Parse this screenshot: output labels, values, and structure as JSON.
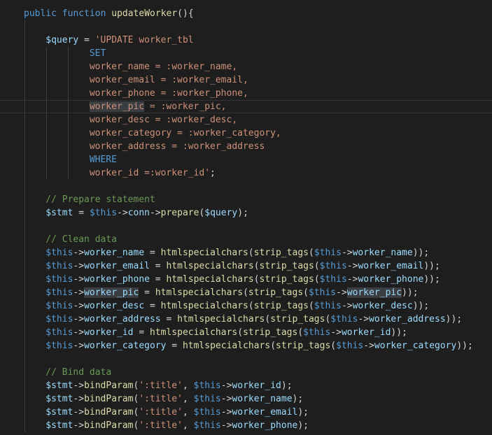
{
  "colors": {
    "background": "#1e1e1e",
    "keyword": "#569cd6",
    "function": "#dcdcaa",
    "variable": "#9cdcfe",
    "string": "#ce9178",
    "comment": "#6a9955",
    "default": "#d4d4d4",
    "indent_guide": "#404040",
    "line_highlight_border": "#333333",
    "word_highlight": "#3a3d41"
  },
  "highlighted_line": 8,
  "code_lines": [
    {
      "indent": 0,
      "guides": [],
      "tokens": [
        {
          "t": "public",
          "c": "keyword"
        },
        {
          "t": " "
        },
        {
          "t": "function",
          "c": "keyword"
        },
        {
          "t": " "
        },
        {
          "t": "updateWorker",
          "c": "function"
        },
        {
          "t": "(){"
        }
      ]
    },
    {
      "indent": 0,
      "guides": [
        1
      ],
      "tokens": []
    },
    {
      "indent": 2,
      "guides": [
        1
      ],
      "tokens": [
        {
          "t": "$query",
          "c": "variable"
        },
        {
          "t": " = "
        },
        {
          "t": "'UPDATE worker_tbl",
          "c": "string"
        }
      ]
    },
    {
      "indent": 6,
      "guides": [
        1,
        2,
        3
      ],
      "tokens": [
        {
          "t": "SET",
          "c": "keyword"
        }
      ]
    },
    {
      "indent": 6,
      "guides": [
        1,
        2,
        3
      ],
      "tokens": [
        {
          "t": "worker_name = :worker_name,",
          "c": "string"
        }
      ]
    },
    {
      "indent": 6,
      "guides": [
        1,
        2,
        3
      ],
      "tokens": [
        {
          "t": "worker_email = :worker_email,",
          "c": "string"
        }
      ]
    },
    {
      "indent": 6,
      "guides": [
        1,
        2,
        3
      ],
      "tokens": [
        {
          "t": "worker_phone = :worker_phone,",
          "c": "string"
        }
      ]
    },
    {
      "indent": 6,
      "guides": [
        1,
        2,
        3
      ],
      "tokens": [
        {
          "t": "worker_pic",
          "c": "string",
          "hl": true
        },
        {
          "t": " = :worker_pic,",
          "c": "string"
        }
      ]
    },
    {
      "indent": 6,
      "guides": [
        1,
        2,
        3
      ],
      "tokens": [
        {
          "t": "worker_desc = :worker_desc,",
          "c": "string"
        }
      ]
    },
    {
      "indent": 6,
      "guides": [
        1,
        2,
        3
      ],
      "tokens": [
        {
          "t": "worker_category = :worker_category,",
          "c": "string"
        }
      ]
    },
    {
      "indent": 6,
      "guides": [
        1,
        2,
        3
      ],
      "tokens": [
        {
          "t": "worker_address = :worker_address",
          "c": "string"
        }
      ]
    },
    {
      "indent": 6,
      "guides": [
        1,
        2,
        3
      ],
      "tokens": [
        {
          "t": "WHERE",
          "c": "keyword"
        }
      ]
    },
    {
      "indent": 6,
      "guides": [
        1,
        2,
        3
      ],
      "tokens": [
        {
          "t": "worker_id =:worker_id'",
          "c": "string"
        },
        {
          "t": ";"
        }
      ]
    },
    {
      "indent": 0,
      "guides": [
        1
      ],
      "tokens": []
    },
    {
      "indent": 2,
      "guides": [
        1
      ],
      "tokens": [
        {
          "t": "// Prepare statement",
          "c": "comment"
        }
      ]
    },
    {
      "indent": 2,
      "guides": [
        1
      ],
      "tokens": [
        {
          "t": "$stmt",
          "c": "variable"
        },
        {
          "t": " = "
        },
        {
          "t": "$this",
          "c": "keyword"
        },
        {
          "t": "->"
        },
        {
          "t": "conn",
          "c": "variable"
        },
        {
          "t": "->"
        },
        {
          "t": "prepare",
          "c": "function"
        },
        {
          "t": "("
        },
        {
          "t": "$query",
          "c": "variable"
        },
        {
          "t": ");"
        }
      ]
    },
    {
      "indent": 0,
      "guides": [
        1
      ],
      "tokens": []
    },
    {
      "indent": 2,
      "guides": [
        1
      ],
      "tokens": [
        {
          "t": "// Clean data",
          "c": "comment"
        }
      ]
    },
    {
      "indent": 2,
      "guides": [
        1
      ],
      "tokens": [
        {
          "t": "$this",
          "c": "keyword"
        },
        {
          "t": "->"
        },
        {
          "t": "worker_name",
          "c": "variable"
        },
        {
          "t": " = "
        },
        {
          "t": "htmlspecialchars",
          "c": "function"
        },
        {
          "t": "("
        },
        {
          "t": "strip_tags",
          "c": "function"
        },
        {
          "t": "("
        },
        {
          "t": "$this",
          "c": "keyword"
        },
        {
          "t": "->"
        },
        {
          "t": "worker_name",
          "c": "variable"
        },
        {
          "t": "));"
        }
      ]
    },
    {
      "indent": 2,
      "guides": [
        1
      ],
      "tokens": [
        {
          "t": "$this",
          "c": "keyword"
        },
        {
          "t": "->"
        },
        {
          "t": "worker_email",
          "c": "variable"
        },
        {
          "t": " = "
        },
        {
          "t": "htmlspecialchars",
          "c": "function"
        },
        {
          "t": "("
        },
        {
          "t": "strip_tags",
          "c": "function"
        },
        {
          "t": "("
        },
        {
          "t": "$this",
          "c": "keyword"
        },
        {
          "t": "->"
        },
        {
          "t": "worker_email",
          "c": "variable"
        },
        {
          "t": "));"
        }
      ]
    },
    {
      "indent": 2,
      "guides": [
        1
      ],
      "tokens": [
        {
          "t": "$this",
          "c": "keyword"
        },
        {
          "t": "->"
        },
        {
          "t": "worker_phone",
          "c": "variable"
        },
        {
          "t": " = "
        },
        {
          "t": "htmlspecialchars",
          "c": "function"
        },
        {
          "t": "("
        },
        {
          "t": "strip_tags",
          "c": "function"
        },
        {
          "t": "("
        },
        {
          "t": "$this",
          "c": "keyword"
        },
        {
          "t": "->"
        },
        {
          "t": "worker_phone",
          "c": "variable"
        },
        {
          "t": "));"
        }
      ]
    },
    {
      "indent": 2,
      "guides": [
        1
      ],
      "tokens": [
        {
          "t": "$this",
          "c": "keyword"
        },
        {
          "t": "->"
        },
        {
          "t": "worker_pic",
          "c": "variable",
          "hl": true
        },
        {
          "t": " = "
        },
        {
          "t": "htmlspecialchars",
          "c": "function"
        },
        {
          "t": "("
        },
        {
          "t": "strip_tags",
          "c": "function"
        },
        {
          "t": "("
        },
        {
          "t": "$this",
          "c": "keyword"
        },
        {
          "t": "->"
        },
        {
          "t": "worker_pic",
          "c": "variable",
          "hl": true
        },
        {
          "t": "));"
        }
      ]
    },
    {
      "indent": 2,
      "guides": [
        1
      ],
      "tokens": [
        {
          "t": "$this",
          "c": "keyword"
        },
        {
          "t": "->"
        },
        {
          "t": "worker_desc",
          "c": "variable"
        },
        {
          "t": " = "
        },
        {
          "t": "htmlspecialchars",
          "c": "function"
        },
        {
          "t": "("
        },
        {
          "t": "strip_tags",
          "c": "function"
        },
        {
          "t": "("
        },
        {
          "t": "$this",
          "c": "keyword"
        },
        {
          "t": "->"
        },
        {
          "t": "worker_desc",
          "c": "variable"
        },
        {
          "t": "));"
        }
      ]
    },
    {
      "indent": 2,
      "guides": [
        1
      ],
      "tokens": [
        {
          "t": "$this",
          "c": "keyword"
        },
        {
          "t": "->"
        },
        {
          "t": "worker_address",
          "c": "variable"
        },
        {
          "t": " = "
        },
        {
          "t": "htmlspecialchars",
          "c": "function"
        },
        {
          "t": "("
        },
        {
          "t": "strip_tags",
          "c": "function"
        },
        {
          "t": "("
        },
        {
          "t": "$this",
          "c": "keyword"
        },
        {
          "t": "->"
        },
        {
          "t": "worker_address",
          "c": "variable"
        },
        {
          "t": "));"
        }
      ]
    },
    {
      "indent": 2,
      "guides": [
        1
      ],
      "tokens": [
        {
          "t": "$this",
          "c": "keyword"
        },
        {
          "t": "->"
        },
        {
          "t": "worker_id",
          "c": "variable"
        },
        {
          "t": " = "
        },
        {
          "t": "htmlspecialchars",
          "c": "function"
        },
        {
          "t": "("
        },
        {
          "t": "strip_tags",
          "c": "function"
        },
        {
          "t": "("
        },
        {
          "t": "$this",
          "c": "keyword"
        },
        {
          "t": "->"
        },
        {
          "t": "worker_id",
          "c": "variable"
        },
        {
          "t": "));"
        }
      ]
    },
    {
      "indent": 2,
      "guides": [
        1
      ],
      "tokens": [
        {
          "t": "$this",
          "c": "keyword"
        },
        {
          "t": "->"
        },
        {
          "t": "worker_category",
          "c": "variable"
        },
        {
          "t": " = "
        },
        {
          "t": "htmlspecialchars",
          "c": "function"
        },
        {
          "t": "("
        },
        {
          "t": "strip_tags",
          "c": "function"
        },
        {
          "t": "("
        },
        {
          "t": "$this",
          "c": "keyword"
        },
        {
          "t": "->"
        },
        {
          "t": "worker_category",
          "c": "variable"
        },
        {
          "t": "));"
        }
      ]
    },
    {
      "indent": 0,
      "guides": [
        1
      ],
      "tokens": []
    },
    {
      "indent": 2,
      "guides": [
        1
      ],
      "tokens": [
        {
          "t": "// Bind data",
          "c": "comment"
        }
      ]
    },
    {
      "indent": 2,
      "guides": [
        1
      ],
      "tokens": [
        {
          "t": "$stmt",
          "c": "variable"
        },
        {
          "t": "->"
        },
        {
          "t": "bindParam",
          "c": "function"
        },
        {
          "t": "("
        },
        {
          "t": "':title'",
          "c": "string"
        },
        {
          "t": ", "
        },
        {
          "t": "$this",
          "c": "keyword"
        },
        {
          "t": "->"
        },
        {
          "t": "worker_id",
          "c": "variable"
        },
        {
          "t": ");"
        }
      ]
    },
    {
      "indent": 2,
      "guides": [
        1
      ],
      "tokens": [
        {
          "t": "$stmt",
          "c": "variable"
        },
        {
          "t": "->"
        },
        {
          "t": "bindParam",
          "c": "function"
        },
        {
          "t": "("
        },
        {
          "t": "':title'",
          "c": "string"
        },
        {
          "t": ", "
        },
        {
          "t": "$this",
          "c": "keyword"
        },
        {
          "t": "->"
        },
        {
          "t": "worker_name",
          "c": "variable"
        },
        {
          "t": ");"
        }
      ]
    },
    {
      "indent": 2,
      "guides": [
        1
      ],
      "tokens": [
        {
          "t": "$stmt",
          "c": "variable"
        },
        {
          "t": "->"
        },
        {
          "t": "bindParam",
          "c": "function"
        },
        {
          "t": "("
        },
        {
          "t": "':title'",
          "c": "string"
        },
        {
          "t": ", "
        },
        {
          "t": "$this",
          "c": "keyword"
        },
        {
          "t": "->"
        },
        {
          "t": "worker_email",
          "c": "variable"
        },
        {
          "t": ");"
        }
      ]
    },
    {
      "indent": 2,
      "guides": [
        1
      ],
      "tokens": [
        {
          "t": "$stmt",
          "c": "variable"
        },
        {
          "t": "->"
        },
        {
          "t": "bindParam",
          "c": "function"
        },
        {
          "t": "("
        },
        {
          "t": "':title'",
          "c": "string"
        },
        {
          "t": ", "
        },
        {
          "t": "$this",
          "c": "keyword"
        },
        {
          "t": "->"
        },
        {
          "t": "worker_phone",
          "c": "variable"
        },
        {
          "t": ");"
        }
      ]
    }
  ]
}
